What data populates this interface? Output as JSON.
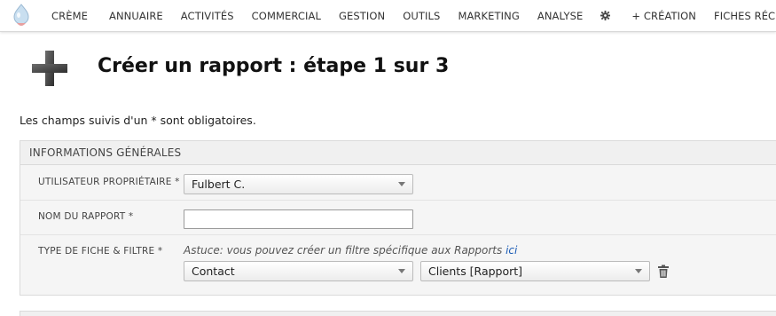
{
  "menu": {
    "items": [
      {
        "label": "CRÈME"
      },
      {
        "label": "ANNUAIRE"
      },
      {
        "label": "ACTIVITÉS"
      },
      {
        "label": "COMMERCIAL"
      },
      {
        "label": "GESTION"
      },
      {
        "label": "OUTILS"
      },
      {
        "label": "MARKETING"
      },
      {
        "label": "ANALYSE"
      }
    ],
    "gear_icon": "gear-icon",
    "creation_label": "+ CRÉATION",
    "recent_label": "FICHES RÉCENTES"
  },
  "page": {
    "icon": "plus-icon",
    "title": "Créer un rapport : étape 1 sur 3",
    "required_note": "Les champs suivis d'un * sont obligatoires."
  },
  "form": {
    "section_title": "INFORMATIONS GÉNÉRALES",
    "owner": {
      "label": "UTILISATEUR PROPRIÉTAIRE *",
      "value": "Fulbert C."
    },
    "name": {
      "label": "NOM DU RAPPORT *",
      "value": ""
    },
    "ctype_filter": {
      "label": "TYPE DE FICHE & FILTRE *",
      "hint_text": "Astuce: vous pouvez créer un filtre spécifique aux Rapports ",
      "hint_link": "ici",
      "ctype_value": "Contact",
      "filter_value": "Clients [Rapport]",
      "delete_icon": "trash-icon"
    }
  },
  "colors": {
    "link": "#1a5bb5",
    "menubar_border": "#d9d9d9",
    "block_bg": "#f5f5f5"
  }
}
